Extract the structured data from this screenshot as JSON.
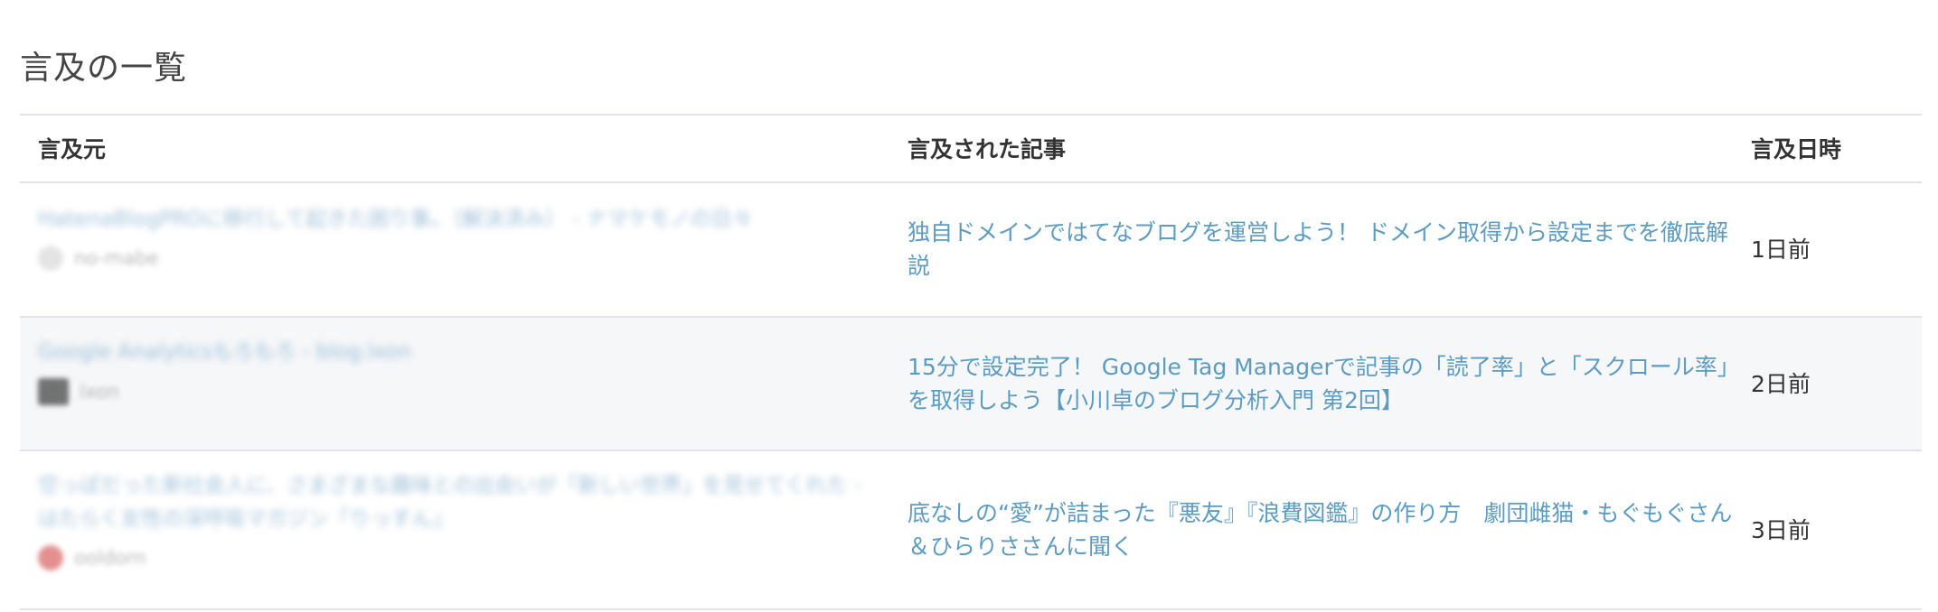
{
  "page": {
    "title": "言及の一覧"
  },
  "table": {
    "headers": {
      "source": "言及元",
      "article": "言及された記事",
      "date": "言及日時"
    },
    "rows": [
      {
        "source_title": "HatenaBlogPROに移行して起きた困り事。（解決済み） - ナマケモノの日々",
        "source_user": "no-mabe",
        "article": "独自ドメインではてなブログを運営しよう！ ドメイン取得から設定までを徹底解説",
        "date": "1日前"
      },
      {
        "source_title": "Google Analyticsもろもろ - blog.lxon",
        "source_user": "lxon",
        "article": "15分で設定完了！ Google Tag Managerで記事の「読了率」と「スクロール率」を取得しよう【小川卓のブログ分析入門 第2回】",
        "date": "2日前"
      },
      {
        "source_title": "空っぽだった新社会人に、さまざまな趣味との出会いが「新しい世界」を見せてくれた - はたらく女性の深呼吸マガジン「りっすん」",
        "source_user": "ooldorn",
        "article": "底なしの“愛”が詰まった『悪友』『浪費図鑑』の作り方　劇団雌猫・もぐもぐさん＆ひらりささんに聞く",
        "date": "3日前"
      }
    ]
  },
  "colors": {
    "link": "#5c9bc2",
    "row_alt_bg": "#f5f7f9",
    "border": "#e2e4e7"
  }
}
